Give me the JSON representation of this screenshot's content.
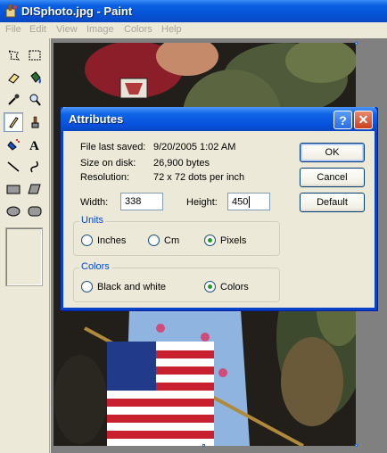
{
  "window": {
    "title": "DISphoto.jpg - Paint"
  },
  "menu": [
    "File",
    "Edit",
    "View",
    "Image",
    "Colors",
    "Help"
  ],
  "toolbox": {
    "tools": [
      "free-select-icon",
      "rect-select-icon",
      "eraser-icon",
      "fill-icon",
      "color-picker-icon",
      "magnifier-icon",
      "pencil-icon",
      "brush-icon",
      "airbrush-icon",
      "text-icon",
      "line-icon",
      "curve-icon",
      "rectangle-icon",
      "polygon-icon",
      "ellipse-icon",
      "rounded-rect-icon"
    ],
    "active_tool": "pencil-icon"
  },
  "dialog": {
    "title": "Attributes",
    "info": {
      "last_saved_label": "File last saved:",
      "last_saved_value": "9/20/2005 1:02 AM",
      "size_label": "Size on disk:",
      "size_value": "26,900 bytes",
      "resolution_label": "Resolution:",
      "resolution_value": "72 x 72 dots per inch"
    },
    "width_label": "Width:",
    "width_value": "338",
    "height_label": "Height:",
    "height_value": "450",
    "units": {
      "label": "Units",
      "options": [
        "Inches",
        "Cm",
        "Pixels"
      ],
      "selected": "Pixels"
    },
    "colors": {
      "label": "Colors",
      "options": [
        "Black and white",
        "Colors"
      ],
      "selected": "Colors"
    },
    "buttons": {
      "ok": "OK",
      "cancel": "Cancel",
      "default": "Default"
    },
    "help_glyph": "?",
    "close_glyph": "✕"
  },
  "colors": {
    "titlebar": "#0554d8",
    "dialog_frame": "#0842c8",
    "group_label": "#0046d5",
    "radio_check": "#21a121"
  }
}
